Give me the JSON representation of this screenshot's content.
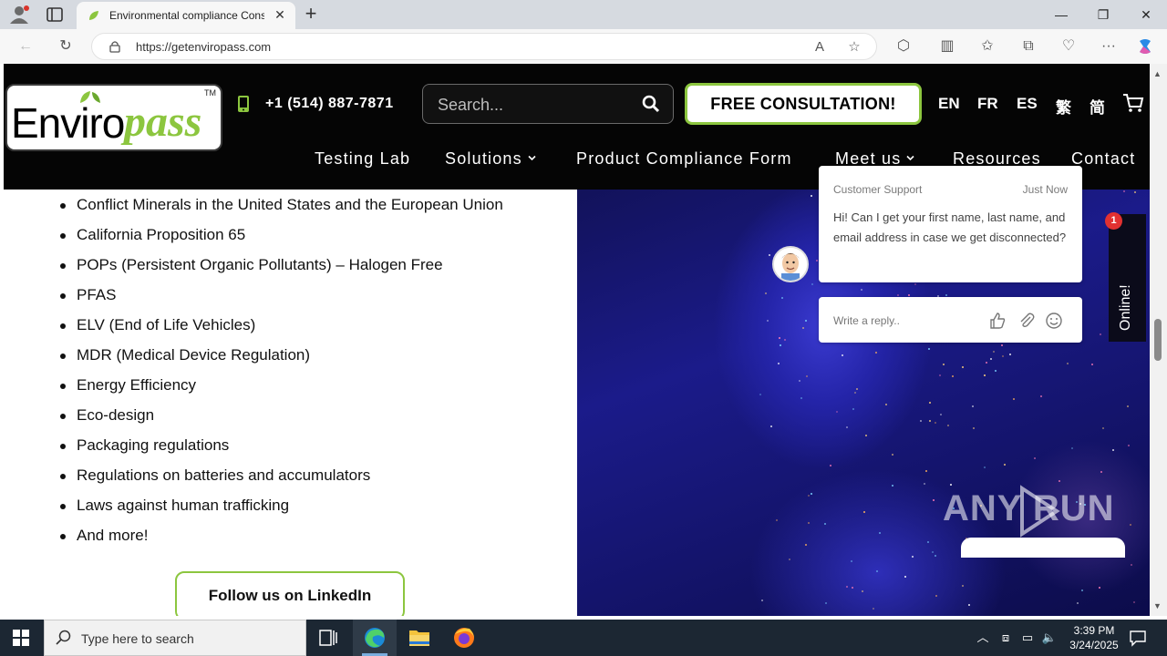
{
  "browser": {
    "tab_title": "Environmental compliance Cons",
    "url": "https://getenviropass.com"
  },
  "site": {
    "logo_text_1": "Enviro",
    "logo_text_2": "pass",
    "logo_tm": "TM",
    "phone": "+1 (514) 887-7871",
    "search_placeholder": "Search...",
    "cta_label": "FREE CONSULTATION!",
    "languages": [
      "EN",
      "FR",
      "ES",
      "繁",
      "简"
    ],
    "nav": [
      "Testing Lab",
      "Solutions",
      "Product Compliance Form",
      "Meet us",
      "Resources",
      "Contact"
    ]
  },
  "content": {
    "list_items": [
      "Conflict Minerals in the United States and the European Union",
      "California Proposition 65",
      "POPs (Persistent Organic Pollutants) – Halogen Free",
      "PFAS",
      "ELV (End of Life Vehicles)",
      "MDR (Medical Device Regulation)",
      "Energy Efficiency",
      "Eco-design",
      "Packaging regulations",
      "Regulations on batteries and accumulators",
      "Laws against human trafficking",
      "And more!"
    ],
    "linkedin_button": "Follow us on LinkedIn"
  },
  "chat": {
    "agent": "Customer Support",
    "time": "Just Now",
    "message": "Hi! Can I get your first name, last name, and email address in case we get disconnected?",
    "reply_placeholder": "Write a reply..",
    "online_label": "Online!",
    "badge_count": "1"
  },
  "watermark": "ANY RUN",
  "taskbar": {
    "search_placeholder": "Type here to search",
    "time": "3:39 PM",
    "date": "3/24/2025"
  },
  "colors": {
    "brand_green": "#8cc63f",
    "header_bg": "#050505",
    "badge_red": "#e23131"
  }
}
